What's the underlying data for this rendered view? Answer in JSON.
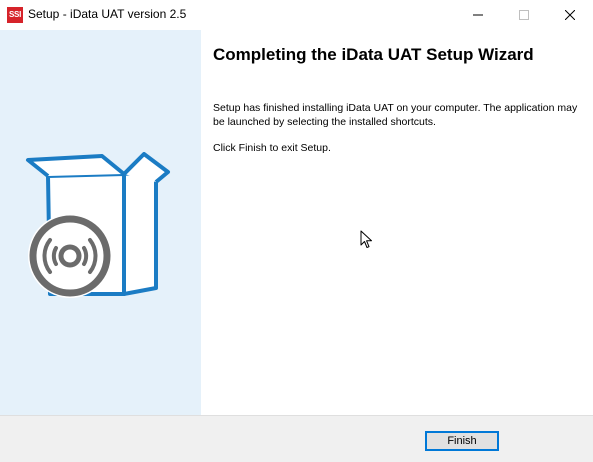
{
  "window": {
    "title": "Setup - iData UAT version 2.5",
    "app_icon_text": "SSI",
    "app_icon_color": "#d6232a"
  },
  "banner": {
    "background": "#e5f1fa",
    "illustration": "software-box-with-disc-icon",
    "accent_color": "#1b7cc4",
    "disc_color": "#6b6b6b"
  },
  "content": {
    "heading": "Completing the iData UAT Setup Wizard",
    "paragraph_1": "Setup has finished installing iData UAT on your computer. The application may be launched by selecting the installed shortcuts.",
    "paragraph_2": "Click Finish to exit Setup."
  },
  "footer": {
    "finish_label": "Finish"
  }
}
